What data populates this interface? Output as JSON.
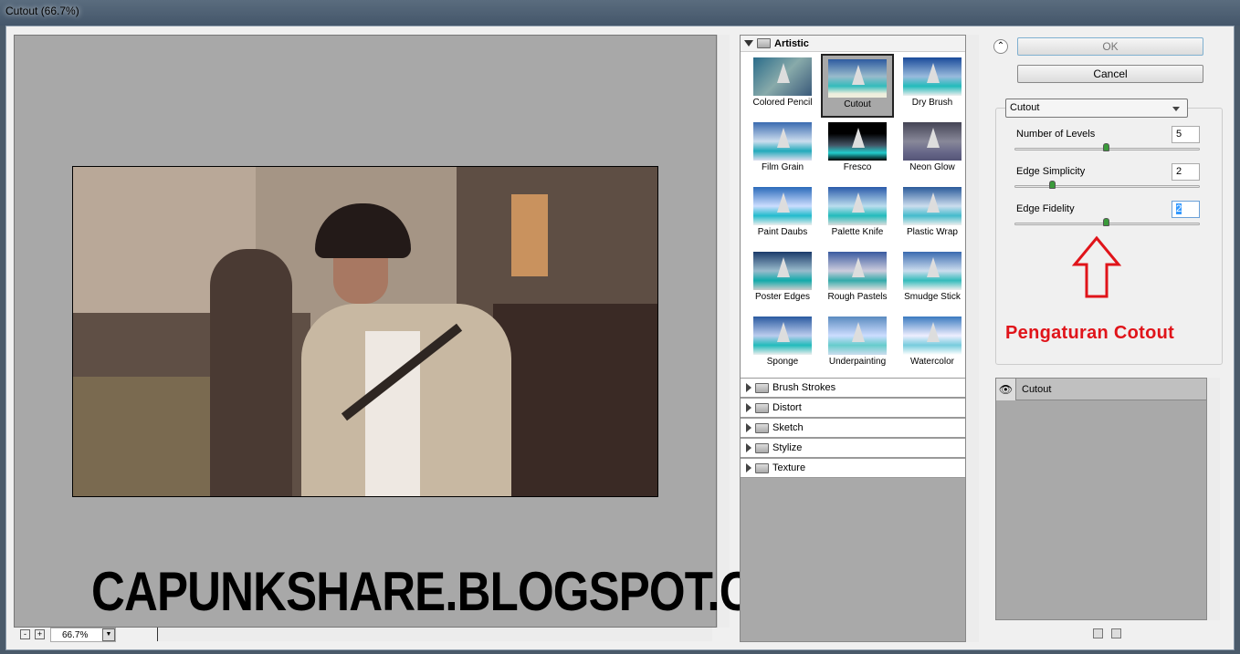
{
  "window": {
    "title": "Cutout (66.7%)"
  },
  "canvas": {
    "zoom": "66.7%",
    "zoom_out_label": "-",
    "zoom_in_label": "+"
  },
  "watermark": "CAPUNKSHARE.BLOGSPOT.COM",
  "gallery": {
    "open_category": "Artistic",
    "filters": [
      {
        "label": "Colored Pencil",
        "selected": false
      },
      {
        "label": "Cutout",
        "selected": true
      },
      {
        "label": "Dry Brush",
        "selected": false
      },
      {
        "label": "Film Grain",
        "selected": false
      },
      {
        "label": "Fresco",
        "selected": false
      },
      {
        "label": "Neon Glow",
        "selected": false
      },
      {
        "label": "Paint Daubs",
        "selected": false
      },
      {
        "label": "Palette Knife",
        "selected": false
      },
      {
        "label": "Plastic Wrap",
        "selected": false
      },
      {
        "label": "Poster Edges",
        "selected": false
      },
      {
        "label": "Rough Pastels",
        "selected": false
      },
      {
        "label": "Smudge Stick",
        "selected": false
      },
      {
        "label": "Sponge",
        "selected": false
      },
      {
        "label": "Underpainting",
        "selected": false
      },
      {
        "label": "Watercolor",
        "selected": false
      }
    ],
    "categories": [
      "Brush Strokes",
      "Distort",
      "Sketch",
      "Stylize",
      "Texture"
    ]
  },
  "buttons": {
    "ok": "OK",
    "cancel": "Cancel"
  },
  "settings": {
    "filter": "Cutout",
    "params": [
      {
        "label": "Number of Levels",
        "value": "5",
        "slider": 0.5
      },
      {
        "label": "Edge Simplicity",
        "value": "2",
        "slider": 0.2
      },
      {
        "label": "Edge Fidelity",
        "value": "2",
        "slider": 0.5
      }
    ]
  },
  "annotation": "Pengaturan Cotout",
  "annotation_color": "#e0141a",
  "layers": [
    {
      "label": "Cutout"
    }
  ]
}
